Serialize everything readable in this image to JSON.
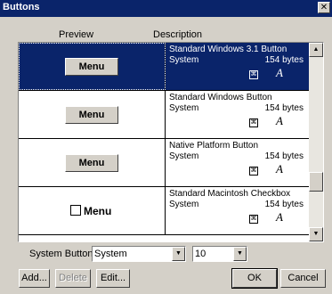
{
  "window": {
    "title": "Buttons",
    "close_glyph": "✕"
  },
  "columns": {
    "preview": "Preview",
    "description": "Description"
  },
  "rows": [
    {
      "preview_label": "Menu",
      "name": "Standard Windows 3.1 Button",
      "type": "System",
      "size": "154 bytes",
      "selected": true
    },
    {
      "preview_label": "Menu",
      "name": "Standard Windows Button",
      "type": "System",
      "size": "154 bytes",
      "selected": false
    },
    {
      "preview_label": "Menu",
      "name": "Native Platform Button",
      "type": "System",
      "size": "154 bytes",
      "selected": false
    },
    {
      "preview_label": "Menu",
      "name": "Standard Macintosh Checkbox",
      "type": "System",
      "size": "154 bytes",
      "selected": false
    }
  ],
  "icons": {
    "command": "command-icon",
    "font": "font-icon",
    "font_glyph": "A",
    "command_glyph": "⌘"
  },
  "system_buttons": {
    "label": "System Buttons:",
    "type_value": "System",
    "size_value": "10"
  },
  "buttons": {
    "add": "Add...",
    "delete": "Delete",
    "edit": "Edit...",
    "ok": "OK",
    "cancel": "Cancel"
  },
  "colors": {
    "selection": "#0a246a",
    "dialog": "#d4d0c8"
  }
}
